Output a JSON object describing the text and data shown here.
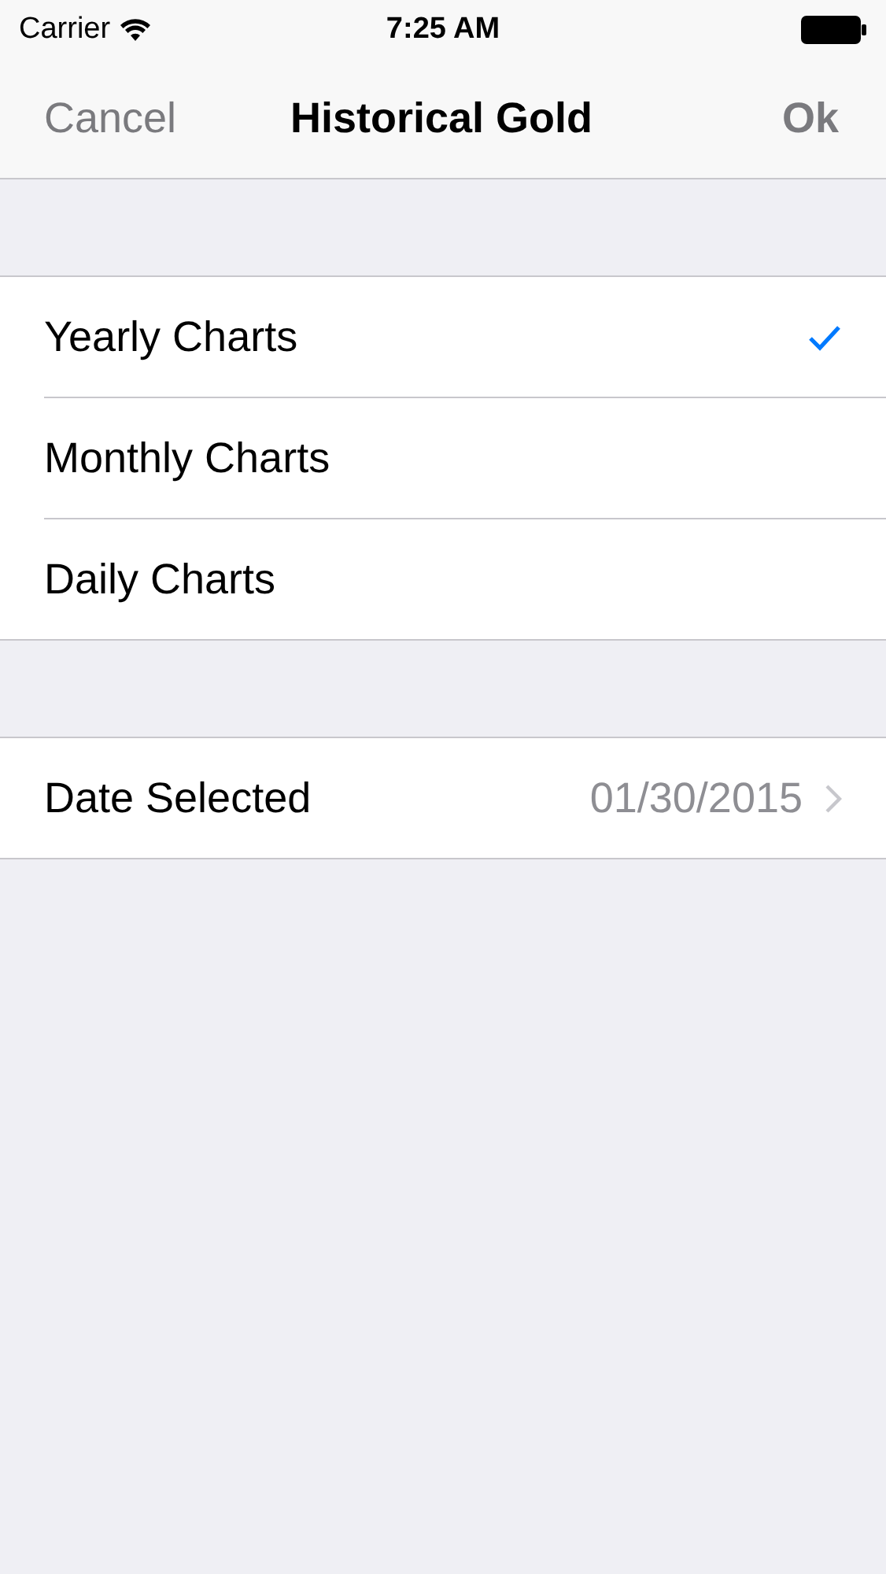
{
  "status_bar": {
    "carrier": "Carrier",
    "time": "7:25 AM"
  },
  "nav": {
    "cancel": "Cancel",
    "title": "Historical Gold",
    "ok": "Ok"
  },
  "chart_options": [
    {
      "label": "Yearly Charts",
      "selected": true
    },
    {
      "label": "Monthly Charts",
      "selected": false
    },
    {
      "label": "Daily Charts",
      "selected": false
    }
  ],
  "date_row": {
    "label": "Date Selected",
    "value": "01/30/2015"
  }
}
